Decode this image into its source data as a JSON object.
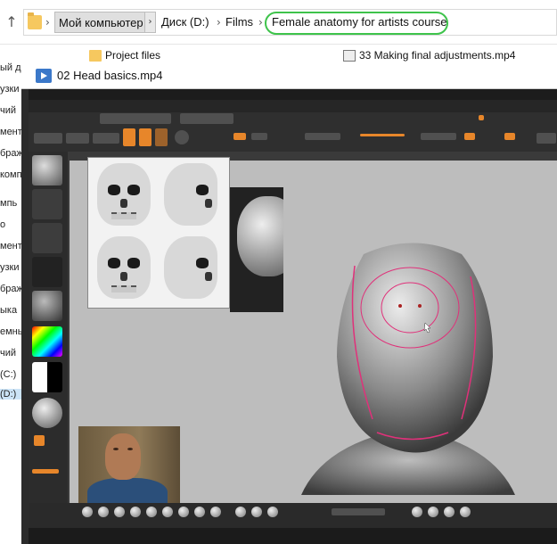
{
  "explorer": {
    "breadcrumb": [
      "Мой компьютер",
      "Диск (D:)",
      "Films",
      "Female anatomy for artists course"
    ],
    "sidebar_fragments": [
      "ый д",
      "узки",
      "чий",
      "мент",
      "браж",
      "комп",
      "мпь",
      "о",
      "мент",
      "узки",
      "браж",
      "ыка",
      "емны",
      "чий",
      "(C:)",
      "(D:)"
    ],
    "files": [
      {
        "name": "Project files",
        "icon": "folder-icon"
      },
      {
        "name": "33 Making final adjustments.mp4",
        "icon": "video-file-icon"
      }
    ]
  },
  "player": {
    "title": "02 Head basics.mp4"
  },
  "colors": {
    "highlight_circle": "#3ec34b",
    "zbrush_orange": "#e7862a",
    "sculpt_lines": "#e0317a"
  }
}
